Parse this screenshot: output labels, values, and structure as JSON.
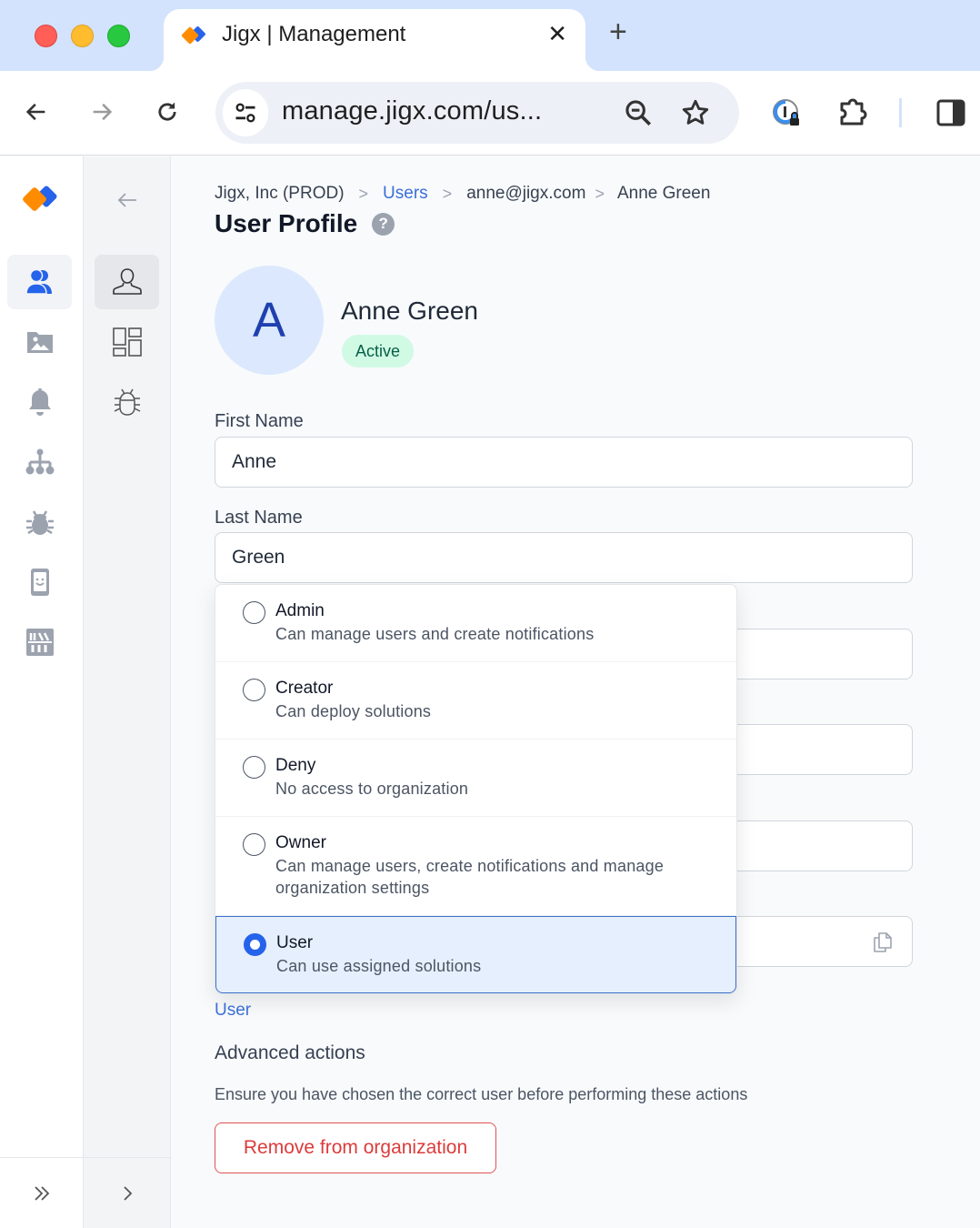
{
  "browser": {
    "tab_title": "Jigx | Management",
    "url": "manage.jigx.com/us...",
    "icons": {
      "back": "arrow-left-icon",
      "forward": "arrow-right-icon",
      "reload": "reload-icon",
      "site_info": "tune-icon",
      "zoom": "zoom-out-icon",
      "bookmark": "star-icon",
      "password_manager": "password-lock-icon",
      "extensions": "puzzle-icon",
      "side_panel": "side-panel-icon"
    }
  },
  "rail": {
    "items": [
      {
        "icon": "users-icon",
        "active": true
      },
      {
        "icon": "folder-image-icon",
        "active": false
      },
      {
        "icon": "bell-icon",
        "active": false
      },
      {
        "icon": "hierarchy-icon",
        "active": false
      },
      {
        "icon": "bug-icon",
        "active": false
      },
      {
        "icon": "mobile-smile-icon",
        "active": false
      },
      {
        "icon": "library-icon",
        "active": false
      }
    ],
    "expand_icon": "double-chevron-right-icon"
  },
  "subnav": {
    "back_icon": "arrow-left-icon",
    "items": [
      {
        "icon": "user-outline-icon",
        "active": true
      },
      {
        "icon": "dashboard-icon",
        "active": false
      },
      {
        "icon": "bug-outline-icon",
        "active": false
      }
    ],
    "expand_icon": "chevron-right-icon"
  },
  "breadcrumb": {
    "items": [
      "Jigx, Inc (PROD)",
      "Users",
      "anne@jigx.com",
      "Anne Green"
    ],
    "separator": ">"
  },
  "page": {
    "title": "User Profile",
    "help": "?"
  },
  "profile": {
    "initial": "A",
    "name": "Anne Green",
    "status": "Active"
  },
  "form": {
    "first_name_label": "First Name",
    "first_name_value": "Anne",
    "last_name_label": "Last Name",
    "last_name_value": "Green"
  },
  "role_menu": {
    "options": [
      {
        "name": "Admin",
        "description": "Can manage users and create notifications",
        "selected": false
      },
      {
        "name": "Creator",
        "description": "Can deploy solutions",
        "selected": false
      },
      {
        "name": "Deny",
        "description": "No access to organization",
        "selected": false
      },
      {
        "name": "Owner",
        "description": "Can manage users, create notifications and manage organization settings",
        "selected": false
      },
      {
        "name": "User",
        "description": "Can use assigned solutions",
        "selected": true
      }
    ],
    "current_value": "User"
  },
  "advanced": {
    "title": "Advanced actions",
    "description": "Ensure you have chosen the correct user before performing these actions",
    "remove_label": "Remove from organization"
  },
  "colors": {
    "accent": "#2563eb",
    "brand_orange": "#ff8c00",
    "brand_blue": "#2563eb",
    "danger": "#dc3b3b",
    "status_active_bg": "#d1fae5",
    "status_active_fg": "#065f46"
  }
}
